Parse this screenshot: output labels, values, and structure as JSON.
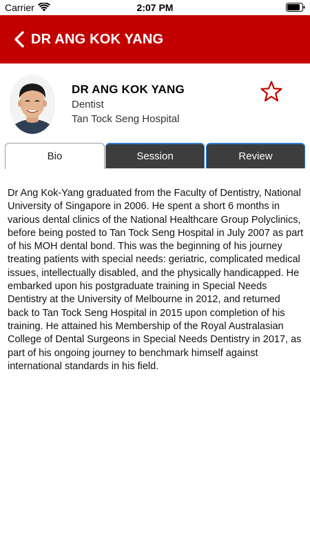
{
  "status_bar": {
    "carrier": "Carrier",
    "time": "2:07 PM",
    "wifi_icon": "wifi-icon",
    "battery_icon": "battery-icon"
  },
  "header": {
    "title": "DR ANG KOK YANG",
    "back_icon": "chevron-left-icon",
    "background_color": "#c20000"
  },
  "profile": {
    "name": "DR ANG KOK YANG",
    "role": "Dentist",
    "hospital": "Tan Tock Seng Hospital",
    "favorite_icon": "star-outline-icon",
    "favorite_color": "#c20000"
  },
  "tabs": [
    {
      "label": "Bio",
      "active": true
    },
    {
      "label": "Session",
      "active": false
    },
    {
      "label": "Review",
      "active": false
    }
  ],
  "bio": "Dr Ang Kok-Yang graduated from the Faculty of Dentistry, National University of Singapore in 2006. He spent a short 6 months in various dental clinics of the National Healthcare Group Polyclinics, before being posted to Tan Tock Seng Hospital in July 2007 as part of his MOH dental bond. This was the beginning of his journey treating patients with special needs: geriatric, complicated medical issues, intellectually disabled, and the physically handicapped. He embarked upon his postgraduate training in Special Needs Dentistry at the University of Melbourne in 2012, and returned back to Tan Tock Seng Hospital in 2015 upon completion of his training. He attained his Membership of the Royal Australasian College of Dental Surgeons in Special Needs Dentistry in 2017, as part of his ongoing journey to benchmark himself against international standards in his field."
}
